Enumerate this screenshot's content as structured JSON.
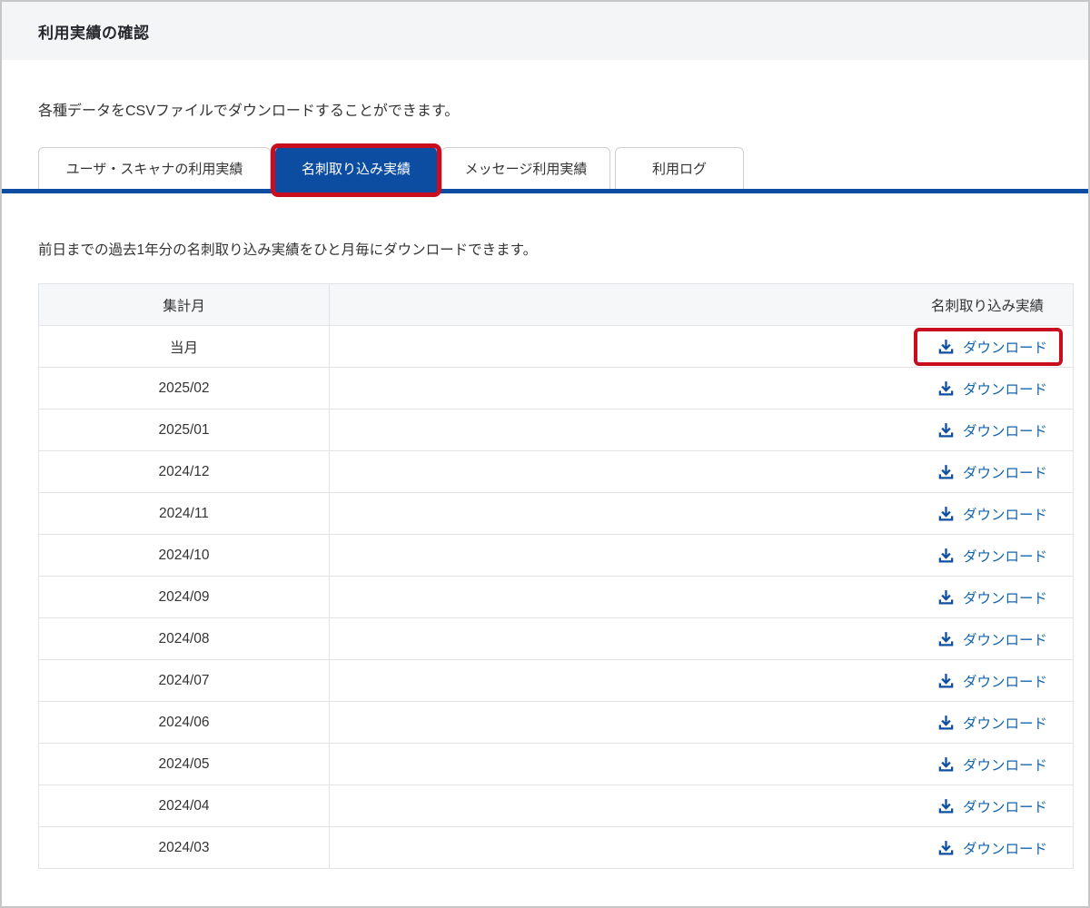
{
  "window": {
    "title": "利用実績の確認"
  },
  "intro": "各種データをCSVファイルでダウンロードすることができます。",
  "tabs": [
    {
      "name": "tab-user-scanner-usage",
      "label": "ユーザ・スキャナの利用実績",
      "active": false,
      "annotated": false
    },
    {
      "name": "tab-business-card-import",
      "label": "名刺取り込み実績",
      "active": true,
      "annotated": true
    },
    {
      "name": "tab-message-usage",
      "label": "メッセージ利用実績",
      "active": false,
      "annotated": false
    },
    {
      "name": "tab-usage-log",
      "label": "利用ログ",
      "active": false,
      "annotated": false
    }
  ],
  "panel": {
    "description": "前日までの過去1年分の名刺取り込み実績をひと月毎にダウンロードできます。"
  },
  "table": {
    "headers": {
      "month": "集計月",
      "result": "名刺取り込み実績"
    },
    "download_label": "ダウンロード",
    "rows": [
      {
        "month": "当月",
        "annotated": true
      },
      {
        "month": "2025/02",
        "annotated": false
      },
      {
        "month": "2025/01",
        "annotated": false
      },
      {
        "month": "2024/12",
        "annotated": false
      },
      {
        "month": "2024/11",
        "annotated": false
      },
      {
        "month": "2024/10",
        "annotated": false
      },
      {
        "month": "2024/09",
        "annotated": false
      },
      {
        "month": "2024/08",
        "annotated": false
      },
      {
        "month": "2024/07",
        "annotated": false
      },
      {
        "month": "2024/06",
        "annotated": false
      },
      {
        "month": "2024/05",
        "annotated": false
      },
      {
        "month": "2024/04",
        "annotated": false
      },
      {
        "month": "2024/03",
        "annotated": false
      }
    ]
  },
  "colors": {
    "accent_blue": "#0c4da1",
    "link_blue": "#1565ad",
    "annotation_red": "#c90d1e"
  }
}
